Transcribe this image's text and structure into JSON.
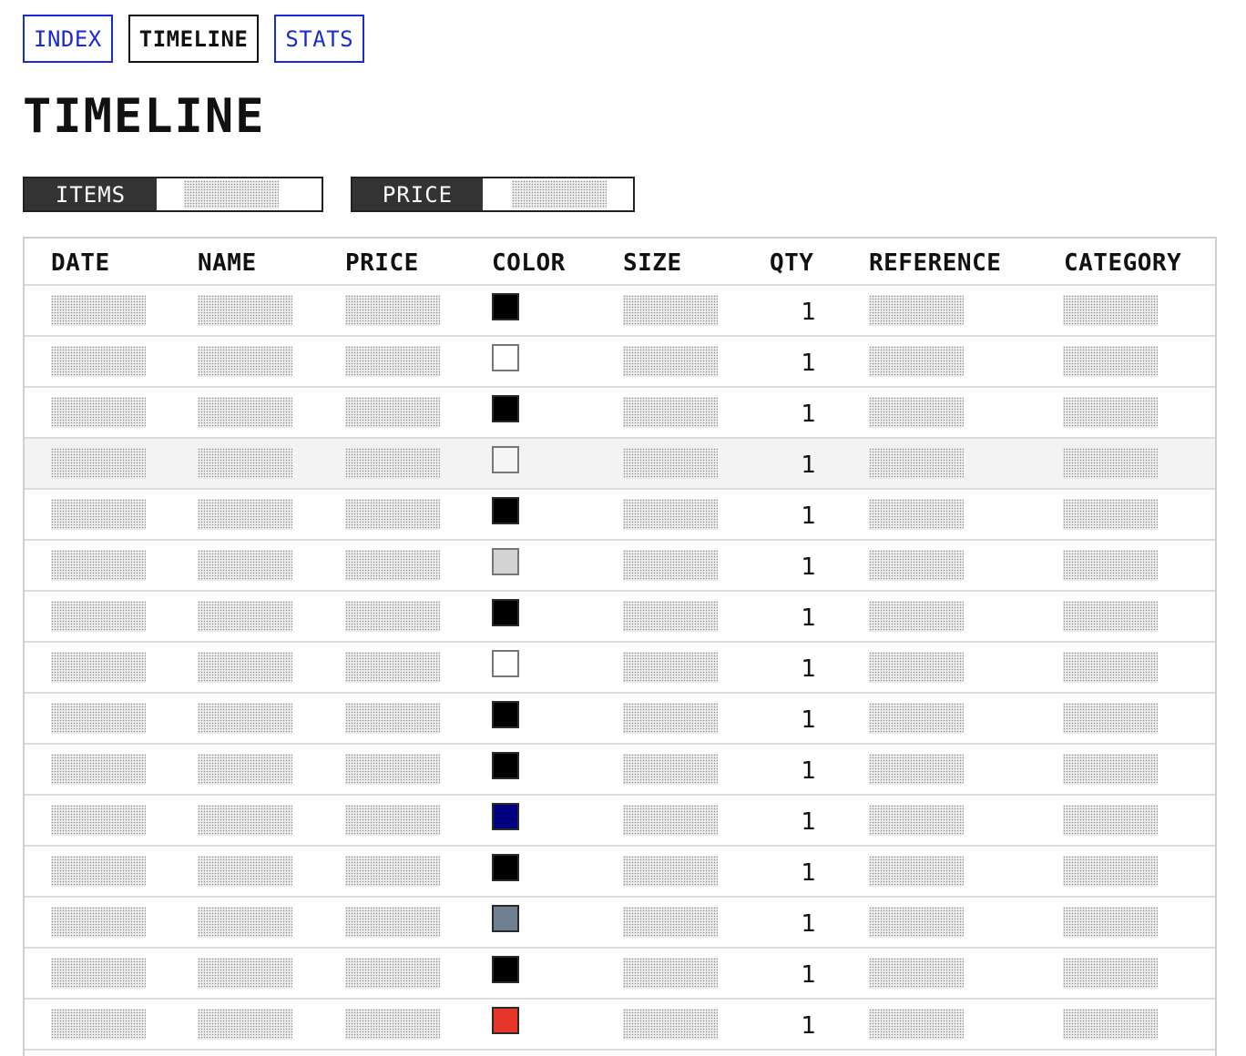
{
  "nav": {
    "tabs": [
      {
        "label": "INDEX",
        "active": false
      },
      {
        "label": "TIMELINE",
        "active": true
      },
      {
        "label": "STATS",
        "active": false
      }
    ]
  },
  "page": {
    "title": "TIMELINE"
  },
  "filters": {
    "items_label": "ITEMS",
    "price_label": "PRICE"
  },
  "table": {
    "headers": [
      "DATE",
      "NAME",
      "PRICE",
      "COLOR",
      "SIZE",
      "QTY",
      "REFERENCE",
      "CATEGORY"
    ],
    "rows": [
      {
        "color": "#000000",
        "qty": "1"
      },
      {
        "color": "#ffffff",
        "qty": "1"
      },
      {
        "color": "#000000",
        "qty": "1"
      },
      {
        "color": "#f5f5f5",
        "qty": "1"
      },
      {
        "color": "#000000",
        "qty": "1"
      },
      {
        "color": "#d3d3d3",
        "qty": "1"
      },
      {
        "color": "#000000",
        "qty": "1"
      },
      {
        "color": "#ffffff",
        "qty": "1"
      },
      {
        "color": "#000000",
        "qty": "1"
      },
      {
        "color": "#000000",
        "qty": "1"
      },
      {
        "color": "#000080",
        "qty": "1"
      },
      {
        "color": "#000000",
        "qty": "1"
      },
      {
        "color": "#708090",
        "qty": "1"
      },
      {
        "color": "#000000",
        "qty": "1"
      },
      {
        "color": "#e8352a",
        "qty": "1"
      },
      {
        "color": "#000000",
        "qty": ""
      }
    ],
    "highlight_row": 3
  }
}
